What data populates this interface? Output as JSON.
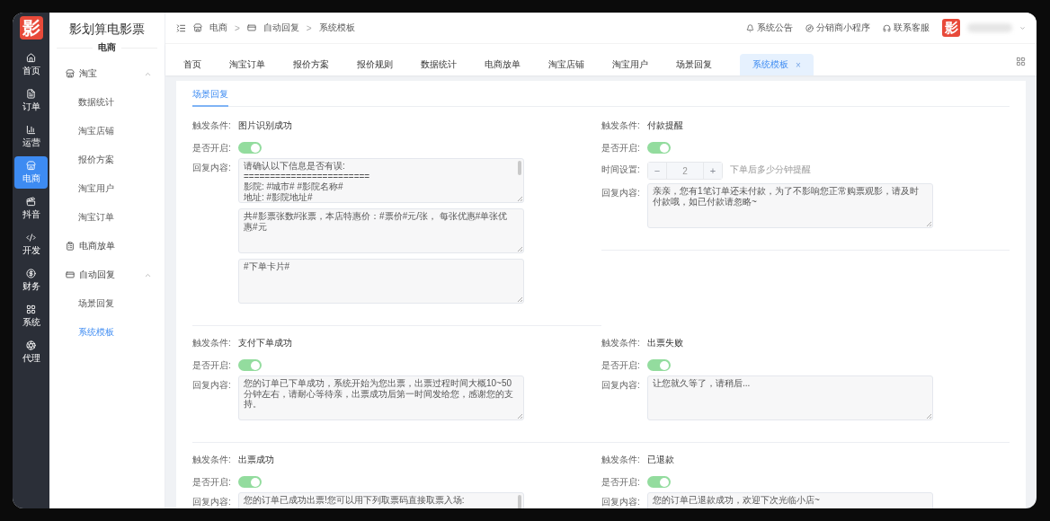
{
  "rail": {
    "logo": "影",
    "items": [
      {
        "label": "首页",
        "selected": false
      },
      {
        "label": "订单",
        "selected": false
      },
      {
        "label": "运营",
        "selected": false
      },
      {
        "label": "电商",
        "selected": true
      },
      {
        "label": "抖音",
        "selected": false
      },
      {
        "label": "开发",
        "selected": false
      },
      {
        "label": "财务",
        "selected": false
      },
      {
        "label": "系统",
        "selected": false
      },
      {
        "label": "代理",
        "selected": false
      }
    ]
  },
  "sidebar": {
    "title": "影划算电影票",
    "subtitle": "电商",
    "menu": [
      {
        "label": "淘宝",
        "expanded": true,
        "children": [
          {
            "label": "数据统计",
            "selected": false
          },
          {
            "label": "淘宝店铺",
            "selected": false
          },
          {
            "label": "报价方案",
            "selected": false
          },
          {
            "label": "淘宝用户",
            "selected": false
          },
          {
            "label": "淘宝订单",
            "selected": false
          }
        ]
      },
      {
        "label": "电商放单"
      },
      {
        "label": "自动回复",
        "expanded": true,
        "children": [
          {
            "label": "场景回复",
            "selected": false
          },
          {
            "label": "系统模板",
            "selected": true
          }
        ]
      }
    ]
  },
  "breadcrumb": {
    "separator": ">",
    "items": [
      "电商",
      "自动回复",
      "系统模板"
    ]
  },
  "header_links": [
    "系统公告",
    "分销商小程序",
    "联系客服"
  ],
  "avatar": "影",
  "tabs": [
    {
      "label": "首页",
      "selected": false
    },
    {
      "label": "淘宝订单",
      "selected": false
    },
    {
      "label": "报价方案",
      "selected": false
    },
    {
      "label": "报价规则",
      "selected": false
    },
    {
      "label": "数据统计",
      "selected": false
    },
    {
      "label": "电商放单",
      "selected": false
    },
    {
      "label": "淘宝店铺",
      "selected": false
    },
    {
      "label": "淘宝用户",
      "selected": false
    },
    {
      "label": "场景回复",
      "selected": false
    },
    {
      "label": "系统模板",
      "selected": true,
      "close": "×"
    }
  ],
  "section_tab": {
    "label": "场景回复",
    "selected": true
  },
  "scenes": [
    {
      "trigger_label": "触发条件:",
      "trigger": "图片识别成功",
      "enabled_label": "是否开启:",
      "enabled": true,
      "reply_label": "回复内容:",
      "replies": [
        {
          "text": "请确认以下信息是否有误:\n========================\n影院: #城市# #影院名称#\n地址: #影院地址#",
          "scrollbar": true
        },
        {
          "text": "共#影票张数#张票，本店特惠价：#票价#元/张， 每张优惠#单张优惠#元",
          "scrollbar": false
        },
        {
          "text": "#下单卡片#",
          "scrollbar": false
        }
      ]
    },
    {
      "trigger_label": "触发条件:",
      "trigger": "付款提醒",
      "enabled_label": "是否开启:",
      "enabled": true,
      "time_setting": {
        "label": "时间设置:",
        "minus": "−",
        "value": "2",
        "plus": "+",
        "hint": "下单后多少分钟提醒"
      },
      "reply_label": "回复内容:",
      "replies": [
        {
          "text": "亲亲，您有1笔订单还未付款，为了不影响您正常购票观影，请及时付款哦，如已付款请忽略~",
          "scrollbar": false
        }
      ]
    },
    {
      "trigger_label": "触发条件:",
      "trigger": "支付下单成功",
      "enabled_label": "是否开启:",
      "enabled": true,
      "reply_label": "回复内容:",
      "replies": [
        {
          "text": "您的订单已下单成功，系统开始为您出票，出票过程时间大概10~50分钟左右，请耐心等待亲，出票成功后第一时间发给您，感谢您的支持。",
          "scrollbar": false
        }
      ]
    },
    {
      "trigger_label": "触发条件:",
      "trigger": "出票失败",
      "enabled_label": "是否开启:",
      "enabled": true,
      "reply_label": "回复内容:",
      "replies": [
        {
          "text": "让您就久等了，请稍后...",
          "scrollbar": false
        }
      ]
    },
    {
      "trigger_label": "触发条件:",
      "trigger": "出票成功",
      "enabled_label": "是否开启:",
      "enabled": true,
      "reply_label": "回复内容:",
      "replies": [
        {
          "text": "您的订单已成功出票!您可以用下列取票码直接取票入场:",
          "scrollbar": true
        }
      ]
    },
    {
      "trigger_label": "触发条件:",
      "trigger": "已退款",
      "enabled_label": "是否开启:",
      "enabled": true,
      "reply_label": "回复内容:",
      "replies": [
        {
          "text": "您的订单已退款成功，欢迎下次光临小店~",
          "scrollbar": false
        }
      ]
    }
  ]
}
